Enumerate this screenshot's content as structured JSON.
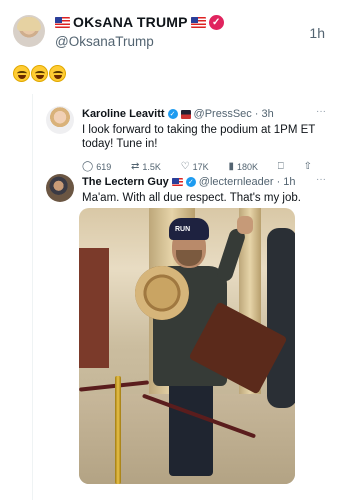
{
  "main_post": {
    "display_name": "OKsANA TRUMP",
    "handle": "@OksanaTrump",
    "time": "1h",
    "emojis": [
      "😂",
      "😂",
      "😂"
    ]
  },
  "quoted": {
    "author_name": "Karoline Leavitt",
    "author_handle": "@PressSec",
    "time": "3h",
    "text": "I look forward to taking the podium at 1PM ET today! Tune in!",
    "stats": {
      "replies": "619",
      "reposts": "1.5K",
      "likes": "17K",
      "views": "180K"
    }
  },
  "reply": {
    "author_name": "The Lectern Guy",
    "author_handle": "@lecternleader",
    "time": "1h",
    "text": "Ma'am. With all due respect. That's my job.",
    "photo_hat_text": "RUN"
  },
  "icons": {
    "more": "more-icon",
    "reply": "reply-icon",
    "repost": "repost-icon",
    "like": "heart-icon",
    "views": "views-icon",
    "bookmark": "bookmark-icon",
    "share": "share-icon"
  },
  "colors": {
    "verified_pink": "#e0245e",
    "verified_blue": "#1d9bf0",
    "muted_text": "#536471"
  }
}
